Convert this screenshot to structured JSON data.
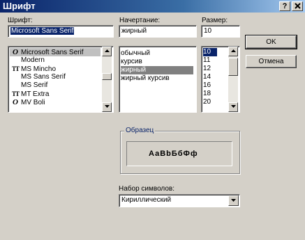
{
  "window": {
    "title": "Шрифт",
    "help_label": "?"
  },
  "font": {
    "label": "Шрифт:",
    "value": "Microsoft Sans Serif",
    "items": [
      {
        "icon": "O",
        "label": "Microsoft Sans Serif"
      },
      {
        "icon": "",
        "label": "Modern"
      },
      {
        "icon": "TT",
        "label": "MS Mincho"
      },
      {
        "icon": "",
        "label": "MS Sans Serif"
      },
      {
        "icon": "",
        "label": "MS Serif"
      },
      {
        "icon": "TT",
        "label": "MT Extra"
      },
      {
        "icon": "O",
        "label": "MV Boli"
      }
    ]
  },
  "style": {
    "label": "Начертание:",
    "value": "жирный",
    "items": [
      "обычный",
      "курсив",
      "жирный",
      "жирный курсив"
    ]
  },
  "size": {
    "label": "Размер:",
    "value": "10",
    "items": [
      "10",
      "11",
      "12",
      "14",
      "16",
      "18",
      "20"
    ]
  },
  "buttons": {
    "ok": "OK",
    "cancel": "Отмена"
  },
  "sample": {
    "label": "Образец",
    "text": "АаВbБбФф"
  },
  "charset": {
    "label": "Набор символов:",
    "value": "Кириллический"
  }
}
